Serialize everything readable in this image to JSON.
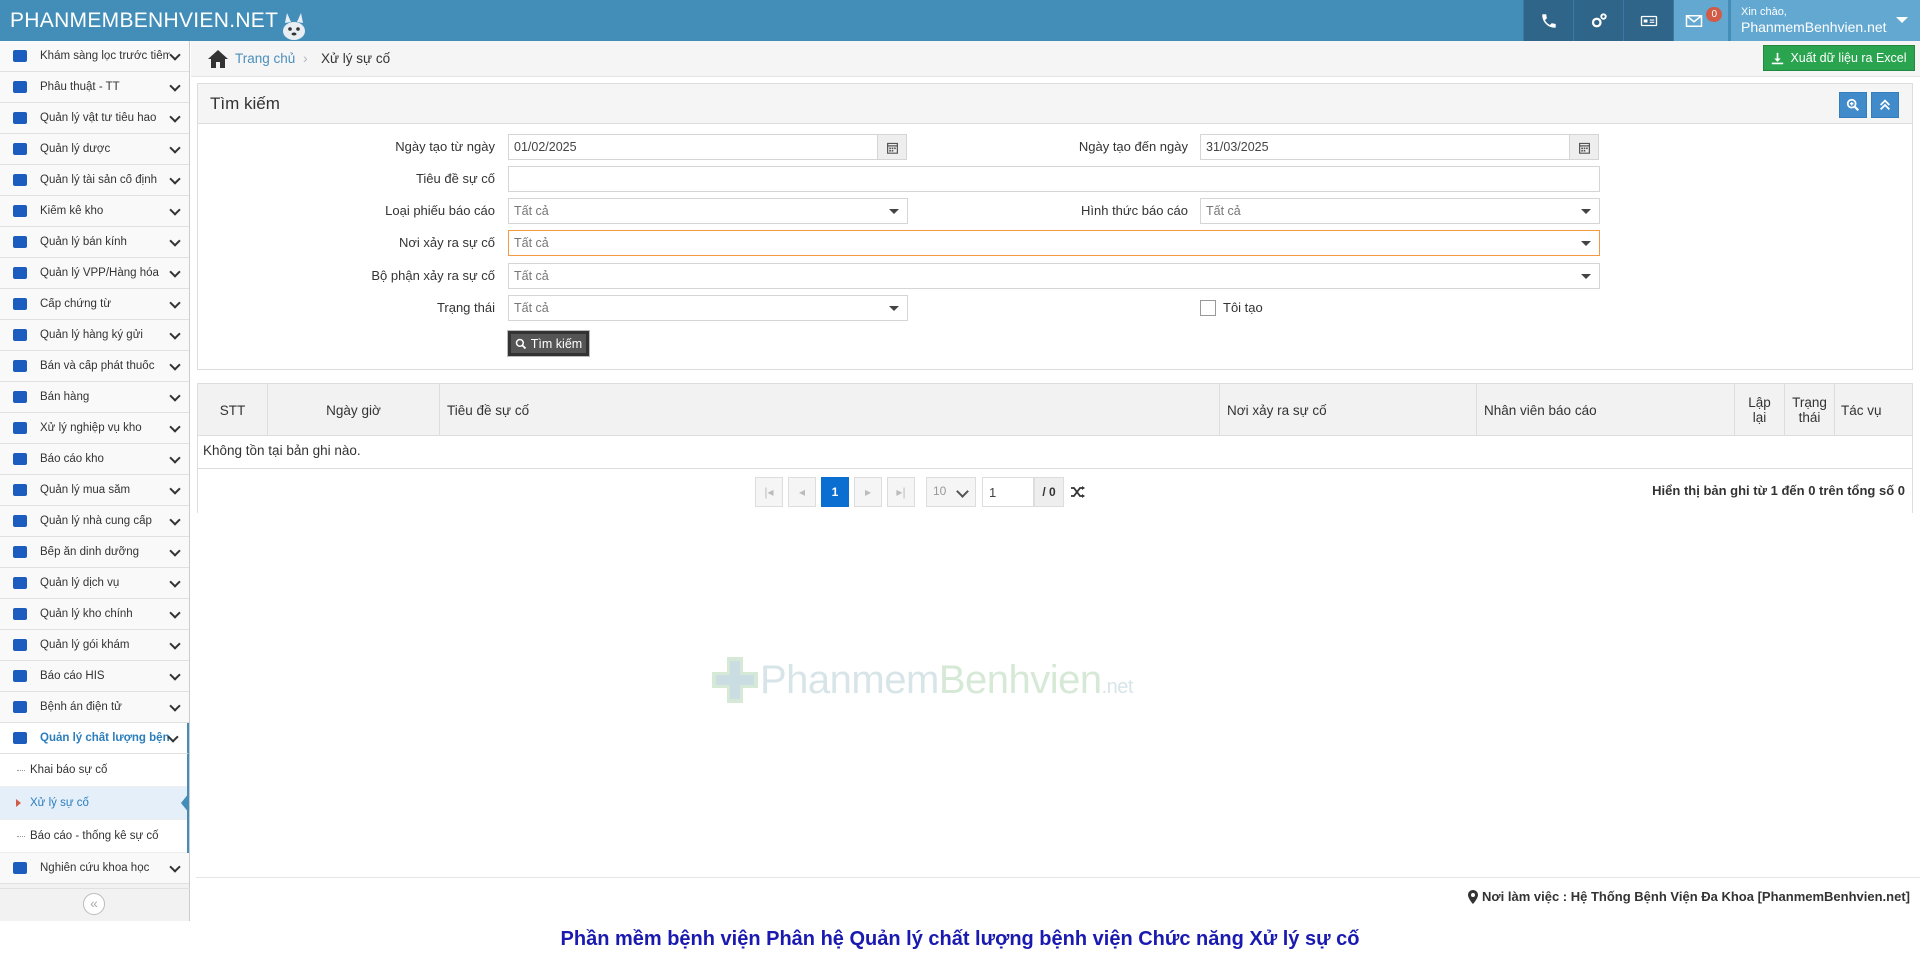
{
  "app": {
    "brand": "PHANMEMBENHVIEN.NET",
    "mail_count": "0",
    "greeting": "Xin chào,",
    "username": "PhanmemBenhvien.net"
  },
  "sidebar": {
    "items": [
      {
        "label": "Khám sàng lọc trước tiêm",
        "icon": "syringe-icon"
      },
      {
        "label": "Phẫu thuật - TT",
        "icon": "scissors-icon"
      },
      {
        "label": "Quản lý vật tư tiêu hao",
        "icon": "pencil-icon"
      },
      {
        "label": "Quản lý dược",
        "icon": "pills-icon"
      },
      {
        "label": "Quản lý tài sản cố định",
        "icon": "cubes-icon"
      },
      {
        "label": "Kiểm kê kho",
        "icon": "check-icon"
      },
      {
        "label": "Quản lý bán kính",
        "icon": "glasses-icon"
      },
      {
        "label": "Quản lý VPP/Hàng hóa",
        "icon": "book-icon"
      },
      {
        "label": "Cấp chứng từ",
        "icon": "document-icon"
      },
      {
        "label": "Quản lý hàng ký gửi",
        "icon": "handshake-icon"
      },
      {
        "label": "Bán và cấp phát thuốc",
        "icon": "pills-icon"
      },
      {
        "label": "Bán hàng",
        "icon": "cart-icon"
      },
      {
        "label": "Xử lý nghiệp vụ kho",
        "icon": "store-icon"
      },
      {
        "label": "Báo cáo kho",
        "icon": "list-icon"
      },
      {
        "label": "Quản lý mua sắm",
        "icon": "cart-icon"
      },
      {
        "label": "Quản lý nhà cung cấp",
        "icon": "truck-icon"
      },
      {
        "label": "Bếp ăn dinh dưỡng",
        "icon": "utensils-icon"
      },
      {
        "label": "Quản lý dịch vụ",
        "icon": "user-md-icon"
      },
      {
        "label": "Quản lý kho chính",
        "icon": "warehouse-icon"
      },
      {
        "label": "Quản lý gói khám",
        "icon": "box-icon"
      },
      {
        "label": "Báo cáo HIS",
        "icon": "folder-icon"
      },
      {
        "label": "Bệnh án điện tử",
        "icon": "profile-icon"
      },
      {
        "label": "Quản lý chất lượng bệnh",
        "icon": "profile-icon"
      }
    ],
    "submenu": [
      {
        "label": "Khai báo sự cố"
      },
      {
        "label": "Xử lý sự cố"
      },
      {
        "label": "Báo cáo - thống kê sự cố"
      }
    ],
    "last_item": {
      "label": "Nghiên cứu khoa học",
      "icon": "profile-icon"
    }
  },
  "breadcrumb": {
    "home": "Trang chủ",
    "current": "Xử lý sự cố"
  },
  "toolbar": {
    "export_label": "Xuất dữ liệu ra Excel"
  },
  "search": {
    "title": "Tìm kiếm",
    "from_date_label": "Ngày tạo từ ngày",
    "from_date_value": "01/02/2025",
    "to_date_label": "Ngày tạo đến ngày",
    "to_date_value": "31/03/2025",
    "subject_label": "Tiêu đề sự cố",
    "subject_value": "",
    "report_type_label": "Loại phiếu báo cáo",
    "report_type_value": "Tất cả",
    "report_form_label": "Hình thức báo cáo",
    "report_form_value": "Tất cả",
    "location_label": "Nơi xảy ra sự cố",
    "location_value": "Tất cả",
    "department_label": "Bộ phận xảy ra sự cố",
    "department_value": "Tất cả",
    "status_label": "Trạng thái",
    "status_value": "Tất cả",
    "created_by_me_label": "Tôi tạo",
    "search_button": "Tìm kiếm"
  },
  "table": {
    "columns": [
      "STT",
      "Ngày giờ",
      "Tiêu đề sự cố",
      "Nơi xảy ra sự cố",
      "Nhân viên báo cáo",
      "Lập lại",
      "Trạng thái",
      "Tác vụ"
    ],
    "empty_message": "Không tồn tại bản ghi nào."
  },
  "pager": {
    "current_page": "1",
    "page_size": "10",
    "page_input": "1",
    "total_pages": "/ 0",
    "info": "Hiển thị bản ghi từ 1 đến 0 trên tổng số 0"
  },
  "watermark": {
    "part1": "Phanmem",
    "part2": "Benhvien",
    "part3": ".net"
  },
  "footer": {
    "workplace": "Nơi làm việc : Hệ Thống Bệnh Viện Đa Khoa [PhanmemBenhvien.net]"
  },
  "caption": "Phần mềm bệnh viện Phân hệ Quản lý chất lượng bệnh viện Chức năng Xử lý sự cố",
  "colors": {
    "navbar": "#438eb9",
    "accent": "#2b7dbc",
    "export_green": "#2aa44f",
    "caption_blue": "#1a1ab0"
  }
}
